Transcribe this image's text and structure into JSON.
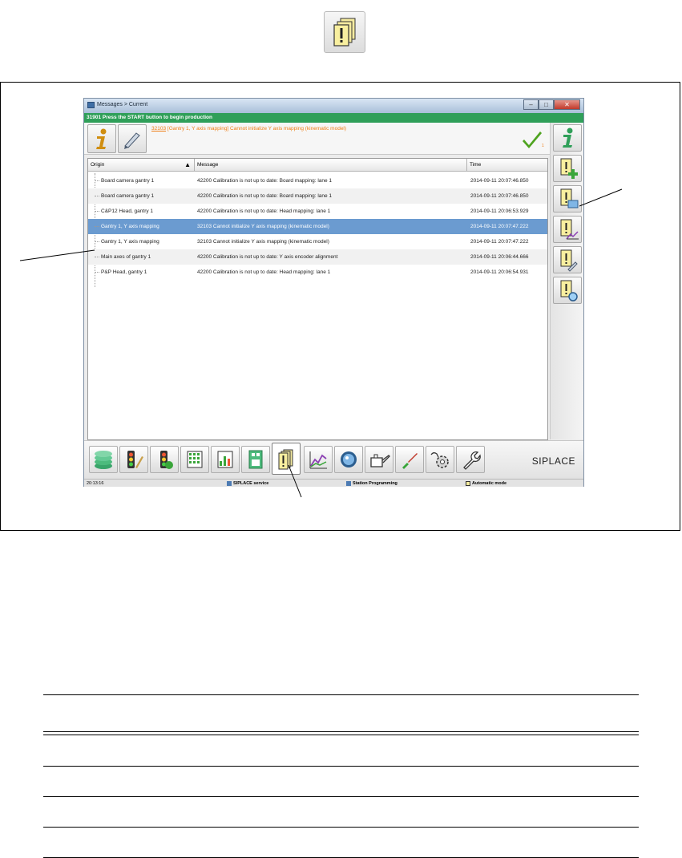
{
  "window": {
    "title": "Messages > Current",
    "status_message": "31901 Press the START button to begin production"
  },
  "current_message": {
    "number": "32103",
    "text": " [Gantry 1, Y axis mapping] Cannot initialize Y axis mapping (kinematic model)",
    "badge": "1"
  },
  "table": {
    "columns": [
      "Origin",
      "Message",
      "Time"
    ],
    "rows": [
      {
        "origin": "Board camera gantry 1",
        "message": "42200 Calibration is not up to date: Board mapping: lane 1",
        "time": "2014-09-11 20:07:46.850"
      },
      {
        "origin": "Board camera gantry 1",
        "message": "42200 Calibration is not up to date: Board mapping: lane 1",
        "time": "2014-09-11 20:07:46.850"
      },
      {
        "origin": "C&P12 Head, gantry 1",
        "message": "42200 Calibration is not up to date: Head mapping: lane 1",
        "time": "2014-09-11 20:06:53.929"
      },
      {
        "origin": "Gantry 1, Y axis mapping",
        "message": "32103 Cannot initialize Y axis mapping (kinematic model)",
        "time": "2014-09-11 20:07:47.222"
      },
      {
        "origin": "Gantry 1, Y axis mapping",
        "message": "32103 Cannot initialize Y axis mapping (kinematic model)",
        "time": "2014-09-11 20:07:47.222"
      },
      {
        "origin": "Main axes of gantry 1",
        "message": "42200 Calibration is not up to date: Y axis encoder alignment",
        "time": "2014-09-11 20:06:44.666"
      },
      {
        "origin": "P&P Head, gantry 1",
        "message": "42200 Calibration is not up to date: Head mapping: lane 1",
        "time": "2014-09-11 20:06:54.931"
      }
    ]
  },
  "brand": "SIPLACE",
  "status_bar": {
    "time": "20:13:16",
    "user": "SIPLACE service",
    "station": "Station Programming",
    "mode": "Automatic mode"
  },
  "colors": {
    "status_green": "#2f9f59",
    "message_orange": "#ef7d16",
    "selection_blue": "#6b9bd0"
  }
}
